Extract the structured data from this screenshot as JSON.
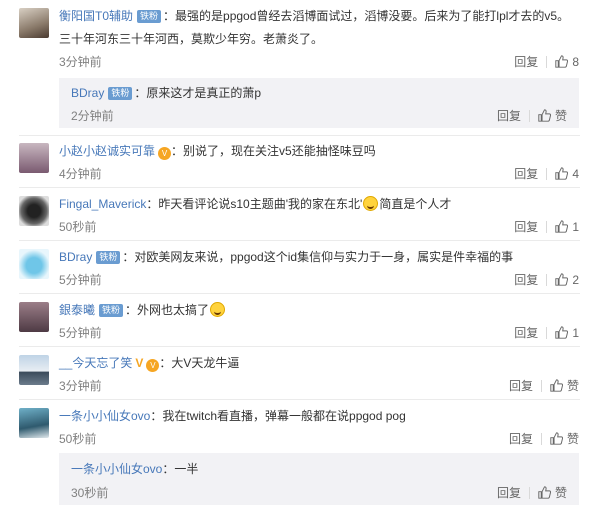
{
  "thread": [
    {
      "id": "c1",
      "user": "衡阳国T0辅助",
      "badge": "铁粉",
      "text_lines": [
        "：最强的是ppgod曾经去滔博面试过，滔博没要。后来为了能打lpl才去的v5。",
        "三十年河东三十年河西，莫欺少年穷。老萧炎了。"
      ],
      "time": "3分钟前",
      "reply": "回复",
      "likes": "8"
    },
    {
      "id": "c1r",
      "user": "BDray",
      "badge": "铁粉",
      "text": "：原来这才是真正的萧p",
      "time": "2分钟前",
      "reply": "回复",
      "likes": "赞"
    },
    {
      "id": "c2",
      "user": "小赵小赵诚实可靠",
      "text": "：别说了，现在关注v5还能抽怪味豆吗",
      "time": "4分钟前",
      "reply": "回复",
      "likes": "4"
    },
    {
      "id": "c3",
      "user": "Fingal_Maverick",
      "text_before": "：昨天看评论说s10主题曲'我的家在东北'",
      "text_after": "简直是个人才",
      "time": "50秒前",
      "reply": "回复",
      "likes": "1"
    },
    {
      "id": "c4",
      "user": "BDray",
      "badge": "铁粉",
      "text": "：对欧美网友来说，ppgod这个id集信仰与实力于一身，属实是件幸福的事",
      "time": "5分钟前",
      "reply": "回复",
      "likes": "2"
    },
    {
      "id": "c5",
      "user": "銀泰曦",
      "badge": "铁粉",
      "text": "：外网也太搞了",
      "time": "5分钟前",
      "reply": "回复",
      "likes": "1"
    },
    {
      "id": "c6",
      "user": "__今天忘了笑",
      "text": "：大V天龙牛逼",
      "time": "3分钟前",
      "reply": "回复",
      "likes": "赞"
    },
    {
      "id": "c7",
      "user": "一条小小仙女ovo",
      "text": "：我在twitch看直播，弹幕一般都在说ppgod pog",
      "time": "50秒前",
      "reply": "回复",
      "likes": "赞"
    },
    {
      "id": "c7r",
      "user": "一条小小仙女ovo",
      "text": "：一半",
      "time": "30秒前",
      "reply": "回复",
      "likes": "赞"
    }
  ],
  "colors": {
    "name": "#4778b9",
    "badge": "#6a9cd1",
    "time": "#808080",
    "subreply_bg": "#f2f2f5"
  }
}
